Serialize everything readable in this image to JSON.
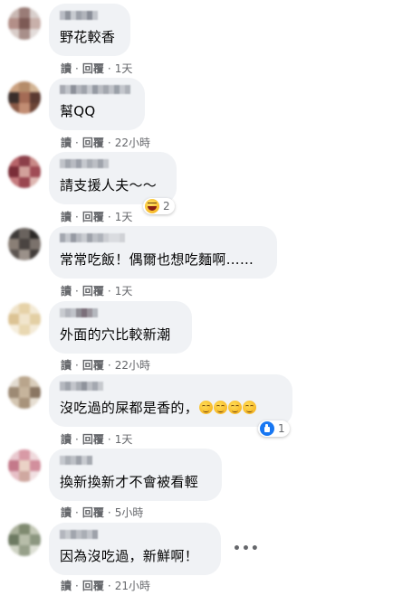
{
  "comments": [
    {
      "text": "野花較香",
      "actions": {
        "read": "讀",
        "reply": "回覆",
        "time": "1天"
      }
    },
    {
      "text": "幫QQ",
      "actions": {
        "read": "讀",
        "reply": "回覆",
        "time": "22小時"
      }
    },
    {
      "text": "請支援人夫～～",
      "actions": {
        "read": "讀",
        "reply": "回覆",
        "time": "1天"
      },
      "reaction": {
        "icon": "laugh-reaction-icon",
        "count": "2"
      }
    },
    {
      "text": "常常吃飯！偶爾也想吃麵啊……",
      "actions": {
        "read": "讀",
        "reply": "回覆",
        "time": "1天"
      }
    },
    {
      "text": "外面的穴比較新潮",
      "actions": {
        "read": "讀",
        "reply": "回覆",
        "time": "22小時"
      }
    },
    {
      "text": "沒吃過的屎都是香的，",
      "emojis": [
        "smirk-emoji",
        "smirk-emoji",
        "smirk-emoji",
        "smirk-emoji"
      ],
      "actions": {
        "read": "讀",
        "reply": "回覆",
        "time": "1天"
      },
      "reaction": {
        "icon": "like-reaction-icon",
        "count": "1"
      }
    },
    {
      "text": "換新換新才不會被看輕",
      "actions": {
        "read": "讀",
        "reply": "回覆",
        "time": "5小時"
      }
    },
    {
      "text": "因為沒吃過，新鮮啊！",
      "actions": {
        "read": "讀",
        "reply": "回覆",
        "time": "21小時"
      },
      "more": "•••"
    }
  ],
  "separator": "·",
  "colors": {
    "bubble": "#f0f2f5",
    "meta": "#65676b",
    "text": "#050505",
    "like": "#1877f2"
  }
}
